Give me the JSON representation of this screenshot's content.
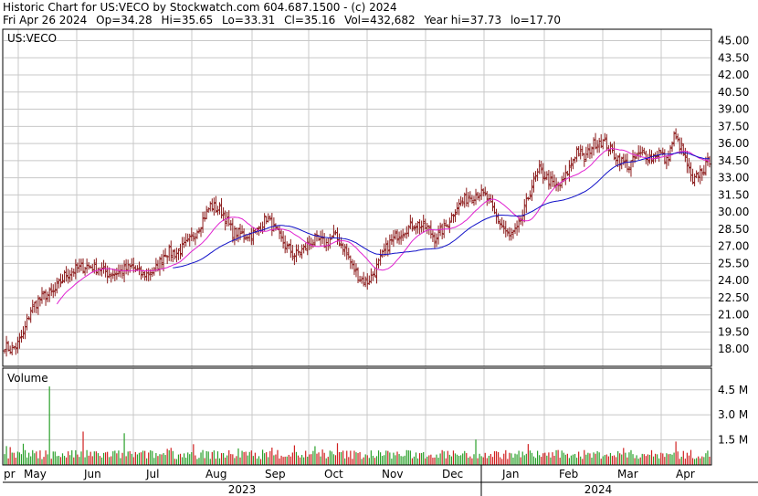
{
  "header": {
    "title": "Historic Chart for US:VECO by Stockwatch.com 604.687.1500 - (c) 2024",
    "date": "Fri Apr 26 2024",
    "open": "Op=34.28",
    "high": "Hi=35.65",
    "low": "Lo=33.31",
    "close": "Cl=35.16",
    "volume": "Vol=432,682",
    "year_high": "Year hi=37.73",
    "year_low": "lo=17.70"
  },
  "chart_data": {
    "type": "ohlc",
    "symbol_label": "US:VECO",
    "volume_label": "Volume",
    "price_axis": {
      "min": 16.5,
      "max": 46.0,
      "ticks": [
        "45.00",
        "43.50",
        "42.00",
        "40.50",
        "39.00",
        "37.50",
        "36.00",
        "34.50",
        "33.00",
        "31.50",
        "30.00",
        "28.50",
        "27.00",
        "25.50",
        "24.00",
        "22.50",
        "21.00",
        "19.50",
        "18.00"
      ]
    },
    "volume_axis": {
      "min": 0,
      "max": 5.8,
      "unit": "M",
      "ticks": [
        "4.5 M",
        "3.0 M",
        "1.5 M"
      ],
      "tick_values": [
        4.5,
        3.0,
        1.5
      ]
    },
    "x_months": [
      "pr",
      "May",
      "Jun",
      "Jul",
      "Aug",
      "Sep",
      "Oct",
      "Nov",
      "Dec",
      "Jan",
      "Feb",
      "Mar",
      "Apr"
    ],
    "x_years": [
      "2023",
      "2024"
    ],
    "price_anchors": [
      [
        0,
        18.3
      ],
      [
        3,
        18.0
      ],
      [
        6,
        18.2
      ],
      [
        10,
        19.3
      ],
      [
        14,
        21.5
      ],
      [
        20,
        22.6
      ],
      [
        26,
        22.9
      ],
      [
        32,
        24.4
      ],
      [
        38,
        25.0
      ],
      [
        44,
        25.3
      ],
      [
        50,
        25.1
      ],
      [
        56,
        24.6
      ],
      [
        62,
        24.8
      ],
      [
        68,
        25.2
      ],
      [
        74,
        24.5
      ],
      [
        80,
        24.8
      ],
      [
        86,
        26.5
      ],
      [
        92,
        26.4
      ],
      [
        98,
        27.3
      ],
      [
        104,
        28.7
      ],
      [
        110,
        30.6
      ],
      [
        116,
        30.1
      ],
      [
        122,
        28.2
      ],
      [
        128,
        28.0
      ],
      [
        134,
        28.1
      ],
      [
        140,
        29.5
      ],
      [
        146,
        28.1
      ],
      [
        150,
        27.1
      ],
      [
        155,
        26.2
      ],
      [
        160,
        26.8
      ],
      [
        166,
        27.6
      ],
      [
        172,
        27.2
      ],
      [
        176,
        28.0
      ],
      [
        182,
        26.8
      ],
      [
        186,
        25.2
      ],
      [
        190,
        24.2
      ],
      [
        194,
        23.9
      ],
      [
        198,
        24.8
      ],
      [
        202,
        26.2
      ],
      [
        206,
        27.3
      ],
      [
        212,
        28.3
      ],
      [
        220,
        29.0
      ],
      [
        226,
        28.6
      ],
      [
        230,
        27.7
      ],
      [
        236,
        28.8
      ],
      [
        242,
        30.5
      ],
      [
        248,
        31.3
      ],
      [
        254,
        31.7
      ],
      [
        258,
        31.2
      ],
      [
        262,
        29.8
      ],
      [
        266,
        28.8
      ],
      [
        270,
        27.8
      ],
      [
        274,
        28.4
      ],
      [
        278,
        30.2
      ],
      [
        282,
        32.4
      ],
      [
        286,
        33.6
      ],
      [
        290,
        33.0
      ],
      [
        294,
        32.2
      ],
      [
        298,
        32.4
      ],
      [
        302,
        33.9
      ],
      [
        306,
        35.4
      ],
      [
        310,
        34.6
      ],
      [
        314,
        35.8
      ],
      [
        318,
        36.3
      ],
      [
        322,
        35.9
      ],
      [
        326,
        35.0
      ],
      [
        330,
        34.4
      ],
      [
        334,
        34.0
      ],
      [
        338,
        34.9
      ],
      [
        342,
        35.1
      ],
      [
        346,
        34.8
      ],
      [
        350,
        35.3
      ],
      [
        354,
        34.4
      ],
      [
        358,
        36.6
      ],
      [
        362,
        35.6
      ],
      [
        365,
        34.1
      ],
      [
        368,
        32.4
      ],
      [
        371,
        33.4
      ],
      [
        374,
        33.8
      ],
      [
        377,
        34.6
      ]
    ],
    "volume_spikes": [
      [
        24,
        4.7
      ],
      [
        42,
        2.0
      ],
      [
        64,
        1.9
      ],
      [
        178,
        1.3
      ],
      [
        359,
        1.4
      ]
    ],
    "series": [
      {
        "name": "MA short",
        "color": "#e020d0",
        "start": 28,
        "window": 20
      },
      {
        "name": "MA long",
        "color": "#1010c8",
        "start": 90,
        "window": 50
      }
    ],
    "colors": {
      "bar": "#8b1a1a",
      "volume_up": "#2aa02a",
      "volume_down": "#d02020",
      "grid": "#c8c8c8"
    }
  }
}
